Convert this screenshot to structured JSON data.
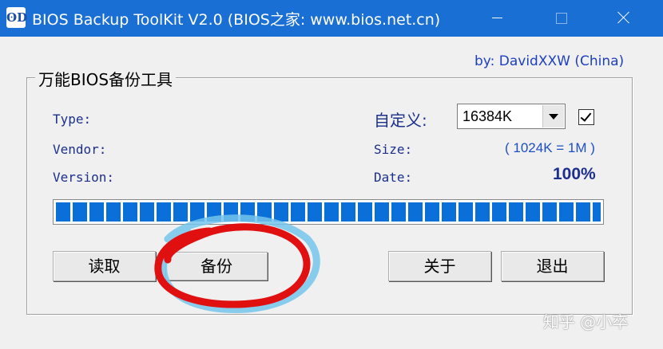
{
  "window": {
    "icon_glyph": "ʘD",
    "title": "BIOS Backup ToolKit V2.0 (BIOS之家: www.bios.net.cn)"
  },
  "author": "by: DavidXXW   (China)",
  "group": {
    "title": "万能BIOS备份工具"
  },
  "labels": {
    "type": "Type:",
    "vendor": "Vendor:",
    "version": "Version:",
    "custom": "自定义:",
    "size": "Size:",
    "date": "Date:"
  },
  "size_select": {
    "value": "16384K",
    "checked": true
  },
  "size_note": "( 1024K = 1M )",
  "progress": {
    "percent_text": "100%",
    "value": 1.0
  },
  "buttons": {
    "read": "读取",
    "backup": "备份",
    "about": "关于",
    "exit": "退出"
  },
  "annotation": {
    "circle_colors": [
      "#e01010",
      "#74c6ec"
    ]
  },
  "watermark": "知乎 @小卒"
}
